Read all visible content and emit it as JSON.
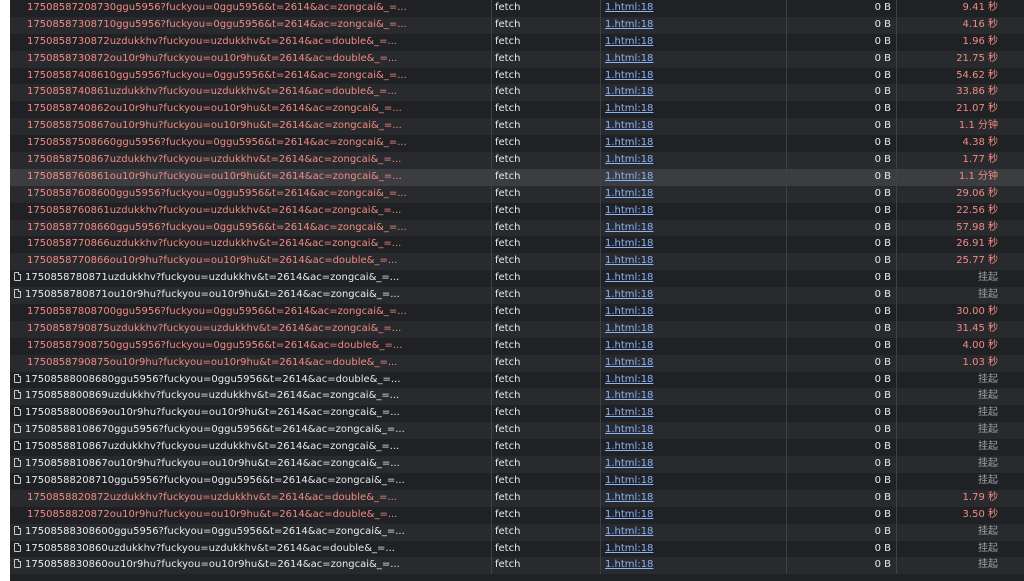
{
  "table": {
    "rows": [
      {
        "name": "1750858720873​0ggu5956?fuckyou=0ggu5956&t=2614&ac=zongcai&_=...",
        "type": "fetch",
        "initiator": "1.html:18",
        "size": "0 B",
        "time": "9.41 秒",
        "status": "failed"
      },
      {
        "name": "17508587308710ggu5956?fuckyou=0ggu5956&t=2614&ac=zongcai&_=...",
        "type": "fetch",
        "initiator": "1.html:18",
        "size": "0 B",
        "time": "4.16 秒",
        "status": "failed"
      },
      {
        "name": "1750858730872uzdukkhv?fuckyou=uzdukkhv&t=2614&ac=double&_=...",
        "type": "fetch",
        "initiator": "1.html:18",
        "size": "0 B",
        "time": "1.96 秒",
        "status": "failed"
      },
      {
        "name": "1750858730872ou10r9hu?fuckyou=ou10r9hu&t=2614&ac=double&_=...",
        "type": "fetch",
        "initiator": "1.html:18",
        "size": "0 B",
        "time": "21.75 秒",
        "status": "failed"
      },
      {
        "name": "17508587408610ggu5956?fuckyou=0ggu5956&t=2614&ac=zongcai&_=...",
        "type": "fetch",
        "initiator": "1.html:18",
        "size": "0 B",
        "time": "54.62 秒",
        "status": "failed"
      },
      {
        "name": "1750858740861uzdukkhv?fuckyou=uzdukkhv&t=2614&ac=double&_=...",
        "type": "fetch",
        "initiator": "1.html:18",
        "size": "0 B",
        "time": "33.86 秒",
        "status": "failed"
      },
      {
        "name": "1750858740862ou10r9hu?fuckyou=ou10r9hu&t=2614&ac=zongcai&_=...",
        "type": "fetch",
        "initiator": "1.html:18",
        "size": "0 B",
        "time": "21.07 秒",
        "status": "failed"
      },
      {
        "name": "1750858750867ou10r9hu?fuckyou=ou10r9hu&t=2614&ac=zongcai&_=...",
        "type": "fetch",
        "initiator": "1.html:18",
        "size": "0 B",
        "time": "1.1 分钟",
        "status": "failed"
      },
      {
        "name": "17508587508660ggu5956?fuckyou=0ggu5956&t=2614&ac=zongcai&_=...",
        "type": "fetch",
        "initiator": "1.html:18",
        "size": "0 B",
        "time": "4.38 秒",
        "status": "failed"
      },
      {
        "name": "1750858750867uzdukkhv?fuckyou=uzdukkhv&t=2614&ac=zongcai&_=...",
        "type": "fetch",
        "initiator": "1.html:18",
        "size": "0 B",
        "time": "1.77 秒",
        "status": "failed"
      },
      {
        "name": "1750858760861ou10r9hu?fuckyou=ou10r9hu&t=2614&ac=zongcai&_=...",
        "type": "fetch",
        "initiator": "1.html:18",
        "size": "0 B",
        "time": "1.1 分钟",
        "status": "failed",
        "highlight": true
      },
      {
        "name": "17508587608600ggu5956?fuckyou=0ggu5956&t=2614&ac=zongcai&_=...",
        "type": "fetch",
        "initiator": "1.html:18",
        "size": "0 B",
        "time": "29.06 秒",
        "status": "failed"
      },
      {
        "name": "1750858760861uzdukkhv?fuckyou=uzdukkhv&t=2614&ac=zongcai&_=...",
        "type": "fetch",
        "initiator": "1.html:18",
        "size": "0 B",
        "time": "22.56 秒",
        "status": "failed"
      },
      {
        "name": "17508587708660ggu5956?fuckyou=0ggu5956&t=2614&ac=zongcai&_=...",
        "type": "fetch",
        "initiator": "1.html:18",
        "size": "0 B",
        "time": "57.98 秒",
        "status": "failed"
      },
      {
        "name": "1750858770866uzdukkhv?fuckyou=uzdukkhv&t=2614&ac=zongcai&_=...",
        "type": "fetch",
        "initiator": "1.html:18",
        "size": "0 B",
        "time": "26.91 秒",
        "status": "failed"
      },
      {
        "name": "1750858770866ou10r9hu?fuckyou=ou10r9hu&t=2614&ac=double&_=...",
        "type": "fetch",
        "initiator": "1.html:18",
        "size": "0 B",
        "time": "25.77 秒",
        "status": "failed"
      },
      {
        "name": "1750858780871uzdukkhv?fuckyou=uzdukkhv&t=2614&ac=zongcai&_=...",
        "type": "fetch",
        "initiator": "1.html:18",
        "size": "0 B",
        "time": "挂起",
        "status": "pending"
      },
      {
        "name": "1750858780871ou10r9hu?fuckyou=ou10r9hu&t=2614&ac=zongcai&_=...",
        "type": "fetch",
        "initiator": "1.html:18",
        "size": "0 B",
        "time": "挂起",
        "status": "pending"
      },
      {
        "name": "17508587808700ggu5956?fuckyou=0ggu5956&t=2614&ac=zongcai&_=...",
        "type": "fetch",
        "initiator": "1.html:18",
        "size": "0 B",
        "time": "30.00 秒",
        "status": "failed"
      },
      {
        "name": "1750858790875uzdukkhv?fuckyou=uzdukkhv&t=2614&ac=zongcai&_=...",
        "type": "fetch",
        "initiator": "1.html:18",
        "size": "0 B",
        "time": "31.45 秒",
        "status": "failed"
      },
      {
        "name": "17508587908750ggu5956?fuckyou=0ggu5956&t=2614&ac=double&_=...",
        "type": "fetch",
        "initiator": "1.html:18",
        "size": "0 B",
        "time": "4.00 秒",
        "status": "failed"
      },
      {
        "name": "1750858790875ou10r9hu?fuckyou=ou10r9hu&t=2614&ac=double&_=...",
        "type": "fetch",
        "initiator": "1.html:18",
        "size": "0 B",
        "time": "1.03 秒",
        "status": "failed"
      },
      {
        "name": "17508588008680ggu5956?fuckyou=0ggu5956&t=2614&ac=double&_=...",
        "type": "fetch",
        "initiator": "1.html:18",
        "size": "0 B",
        "time": "挂起",
        "status": "pending"
      },
      {
        "name": "1750858800869uzdukkhv?fuckyou=uzdukkhv&t=2614&ac=zongcai&_=...",
        "type": "fetch",
        "initiator": "1.html:18",
        "size": "0 B",
        "time": "挂起",
        "status": "pending"
      },
      {
        "name": "1750858800869ou10r9hu?fuckyou=ou10r9hu&t=2614&ac=zongcai&_=...",
        "type": "fetch",
        "initiator": "1.html:18",
        "size": "0 B",
        "time": "挂起",
        "status": "pending"
      },
      {
        "name": "17508588108670ggu5956?fuckyou=0ggu5956&t=2614&ac=zongcai&_=...",
        "type": "fetch",
        "initiator": "1.html:18",
        "size": "0 B",
        "time": "挂起",
        "status": "pending"
      },
      {
        "name": "1750858810867uzdukkhv?fuckyou=uzdukkhv&t=2614&ac=zongcai&_=...",
        "type": "fetch",
        "initiator": "1.html:18",
        "size": "0 B",
        "time": "挂起",
        "status": "pending"
      },
      {
        "name": "1750858810867ou10r9hu?fuckyou=ou10r9hu&t=2614&ac=zongcai&_=...",
        "type": "fetch",
        "initiator": "1.html:18",
        "size": "0 B",
        "time": "挂起",
        "status": "pending"
      },
      {
        "name": "17508588208710ggu5956?fuckyou=0ggu5956&t=2614&ac=zongcai&_=...",
        "type": "fetch",
        "initiator": "1.html:18",
        "size": "0 B",
        "time": "挂起",
        "status": "pending"
      },
      {
        "name": "1750858820872uzdukkhv?fuckyou=uzdukkhv&t=2614&ac=double&_=...",
        "type": "fetch",
        "initiator": "1.html:18",
        "size": "0 B",
        "time": "1.79 秒",
        "status": "failed"
      },
      {
        "name": "1750858820872ou10r9hu?fuckyou=ou10r9hu&t=2614&ac=double&_=...",
        "type": "fetch",
        "initiator": "1.html:18",
        "size": "0 B",
        "time": "3.50 秒",
        "status": "failed"
      },
      {
        "name": "17508588308600ggu5956?fuckyou=0ggu5956&t=2614&ac=zongcai&_=...",
        "type": "fetch",
        "initiator": "1.html:18",
        "size": "0 B",
        "time": "挂起",
        "status": "pending"
      },
      {
        "name": "1750858830860uzdukkhv?fuckyou=uzdukkhv&t=2614&ac=double&_=...",
        "type": "fetch",
        "initiator": "1.html:18",
        "size": "0 B",
        "time": "挂起",
        "status": "pending"
      },
      {
        "name": "1750858830860ou10r9hu?fuckyou=ou10r9hu&t=2614&ac=zongcai&_=...",
        "type": "fetch",
        "initiator": "1.html:18",
        "size": "0 B",
        "time": "挂起",
        "status": "pending"
      }
    ]
  },
  "colors": {
    "background": "#202124",
    "row_alt": "#292a2d",
    "row_highlight": "#3c3d40",
    "failed_text": "#f28b82",
    "link": "#8ab4f8"
  },
  "icons": {
    "pending_row": "document-icon"
  }
}
